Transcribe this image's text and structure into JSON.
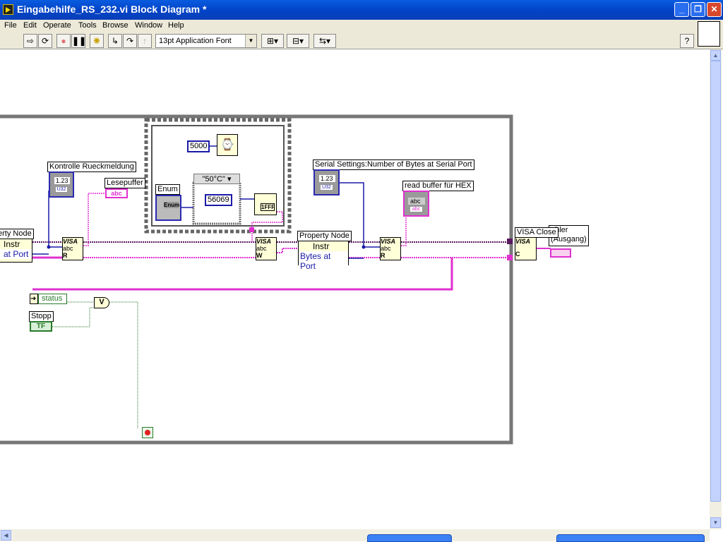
{
  "window": {
    "title": "Eingabehilfe_RS_232.vi Block Diagram *"
  },
  "menu": [
    "File",
    "Edit",
    "Operate",
    "Tools",
    "Browse",
    "Window",
    "Help"
  ],
  "toolbar": {
    "font": "13pt Application Font",
    "help": "?"
  },
  "diagram": {
    "property_node_left": {
      "title": "erty Node",
      "ref": "Instr",
      "prop": "at Port"
    },
    "kontrolle": {
      "label": "Kontrolle Rueckmeldung",
      "value": "1.23",
      "type": "U32"
    },
    "lesepuffer": {
      "label": "Lesepuffer",
      "type": "abc"
    },
    "wait_const": "5000",
    "enum": {
      "label": "Enum",
      "text": "Enum"
    },
    "case_selector": "\"50°C\"",
    "case_const": "56069",
    "hex_fmt": "1FFF",
    "visa_read1": {
      "top": "VISA",
      "mid": "abc",
      "mode": "R"
    },
    "visa_write": {
      "top": "VISA",
      "mid": "abc",
      "mode": "W"
    },
    "serial_settings": {
      "label": "Serial Settings:Number of Bytes at Serial Port",
      "value": "1.23",
      "type": "U32"
    },
    "read_hex": {
      "label": "read buffer für HEX",
      "value": "abc",
      "type": "abc"
    },
    "property_node_right": {
      "title": "Property Node",
      "ref": "Instr",
      "prop": "Bytes at Port"
    },
    "visa_read2": {
      "top": "VISA",
      "mid": "abc",
      "mode": "R"
    },
    "visa_close": {
      "label": "VISA Close",
      "top": "VISA",
      "mode": "C"
    },
    "fehler": {
      "label": "ehler\n(Ausgang)"
    },
    "status": "status",
    "stopp": {
      "label": "Stopp",
      "value": "TF"
    },
    "or_gate": "V"
  },
  "colors": {
    "titlebar": "#0a5ce0",
    "refwire": "#5a1a60",
    "errwire": "#e030d0",
    "numwire": "#1a1aa8",
    "boolwire": "#2a7a2a"
  }
}
